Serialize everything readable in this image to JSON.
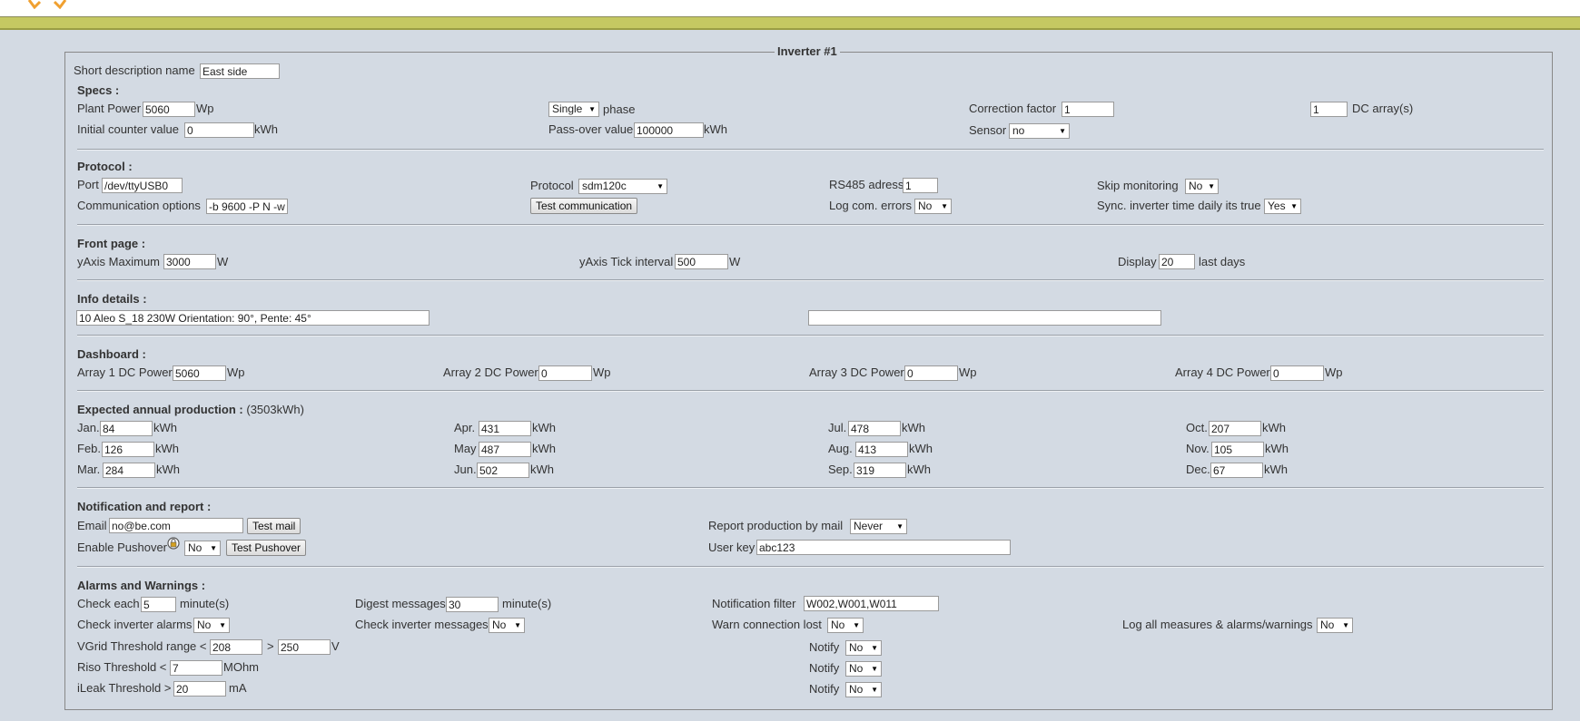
{
  "fieldset_title": "Inverter #1",
  "short_desc": {
    "label": "Short description name",
    "value": "East side"
  },
  "specs": {
    "title": "Specs :",
    "plant_power": {
      "label": "Plant Power",
      "value": "5060",
      "unit": "Wp"
    },
    "phase": {
      "value": "Single",
      "label": "phase"
    },
    "correction": {
      "label": "Correction factor",
      "value": "1"
    },
    "dc_arrays": {
      "value": "1",
      "label": "DC array(s)"
    },
    "initial_counter": {
      "label": "Initial counter value",
      "value": "0",
      "unit": "kWh"
    },
    "passover": {
      "label": "Pass-over value",
      "value": "100000",
      "unit": "kWh"
    },
    "sensor": {
      "label": "Sensor",
      "value": "no"
    }
  },
  "protocol": {
    "title": "Protocol :",
    "port": {
      "label": "Port",
      "value": "/dev/ttyUSB0"
    },
    "protocol": {
      "label": "Protocol",
      "value": "sdm120c"
    },
    "rs485": {
      "label": "RS485 adress",
      "value": "1"
    },
    "skip": {
      "label": "Skip monitoring",
      "value": "No"
    },
    "comm_options": {
      "label": "Communication options",
      "value": "-b 9600 -P N -w"
    },
    "test_button": "Test communication",
    "log_errors": {
      "label": "Log com. errors",
      "value": "No"
    },
    "sync_time": {
      "label": "Sync. inverter time daily its true",
      "value": "Yes"
    }
  },
  "front_page": {
    "title": "Front page :",
    "yaxis_max": {
      "label": "yAxis Maximum",
      "value": "3000",
      "unit": "W"
    },
    "yaxis_tick": {
      "label": "yAxis Tick interval",
      "value": "500",
      "unit": "W"
    },
    "display": {
      "label": "Display",
      "value": "20",
      "unit": "last days"
    }
  },
  "info": {
    "title": "Info details :",
    "line1": "10 Aleo S_18 230W Orientation: 90°, Pente: 45°",
    "line2": ""
  },
  "dashboard": {
    "title": "Dashboard :",
    "arrays": [
      {
        "label": "Array 1 DC Power",
        "value": "5060",
        "unit": "Wp"
      },
      {
        "label": "Array 2 DC Power",
        "value": "0",
        "unit": "Wp"
      },
      {
        "label": "Array 3 DC Power",
        "value": "0",
        "unit": "Wp"
      },
      {
        "label": "Array 4 DC Power",
        "value": "0",
        "unit": "Wp"
      }
    ]
  },
  "expected": {
    "title": "Expected annual production :",
    "total": "(3503kWh)",
    "unit": "kWh",
    "months": [
      {
        "label": "Jan.",
        "value": "84"
      },
      {
        "label": "Feb.",
        "value": "126"
      },
      {
        "label": "Mar.",
        "value": "284"
      },
      {
        "label": "Apr.",
        "value": "431"
      },
      {
        "label": "May",
        "value": "487"
      },
      {
        "label": "Jun.",
        "value": "502"
      },
      {
        "label": "Jul.",
        "value": "478"
      },
      {
        "label": "Aug.",
        "value": "413"
      },
      {
        "label": "Sep.",
        "value": "319"
      },
      {
        "label": "Oct.",
        "value": "207"
      },
      {
        "label": "Nov.",
        "value": "105"
      },
      {
        "label": "Dec.",
        "value": "67"
      }
    ]
  },
  "notification": {
    "title": "Notification and report :",
    "email": {
      "label": "Email",
      "value": "no@be.com"
    },
    "test_mail": "Test mail",
    "report": {
      "label": "Report production by mail",
      "value": "Never"
    },
    "pushover": {
      "label": "Enable Pushover",
      "value": "No"
    },
    "test_pushover": "Test Pushover",
    "user_key": {
      "label": "User key",
      "value": "abc123"
    }
  },
  "alarms": {
    "title": "Alarms and Warnings :",
    "check_each": {
      "label": "Check each",
      "value": "5",
      "unit": "minute(s)"
    },
    "digest": {
      "label": "Digest messages",
      "value": "30",
      "unit": "minute(s)"
    },
    "notif_filter": {
      "label": "Notification filter",
      "value": "W002,W001,W011"
    },
    "check_alarms": {
      "label": "Check inverter alarms",
      "value": "No"
    },
    "check_messages": {
      "label": "Check inverter messages",
      "value": "No"
    },
    "warn_lost": {
      "label": "Warn connection lost",
      "value": "No"
    },
    "log_all": {
      "label": "Log all measures & alarms/warnings",
      "value": "No"
    },
    "vgrid": {
      "label": "VGrid Threshold range <",
      "low": "208",
      "gt": ">",
      "high": "250",
      "unit": "V"
    },
    "riso": {
      "label": "Riso Threshold <",
      "value": "7",
      "unit": "MOhm"
    },
    "ileak": {
      "label": "iLeak Threshold >",
      "value": "20",
      "unit": "mA"
    },
    "notify_label": "Notify",
    "notify_vgrid": "No",
    "notify_riso": "No",
    "notify_ileak": "No"
  }
}
